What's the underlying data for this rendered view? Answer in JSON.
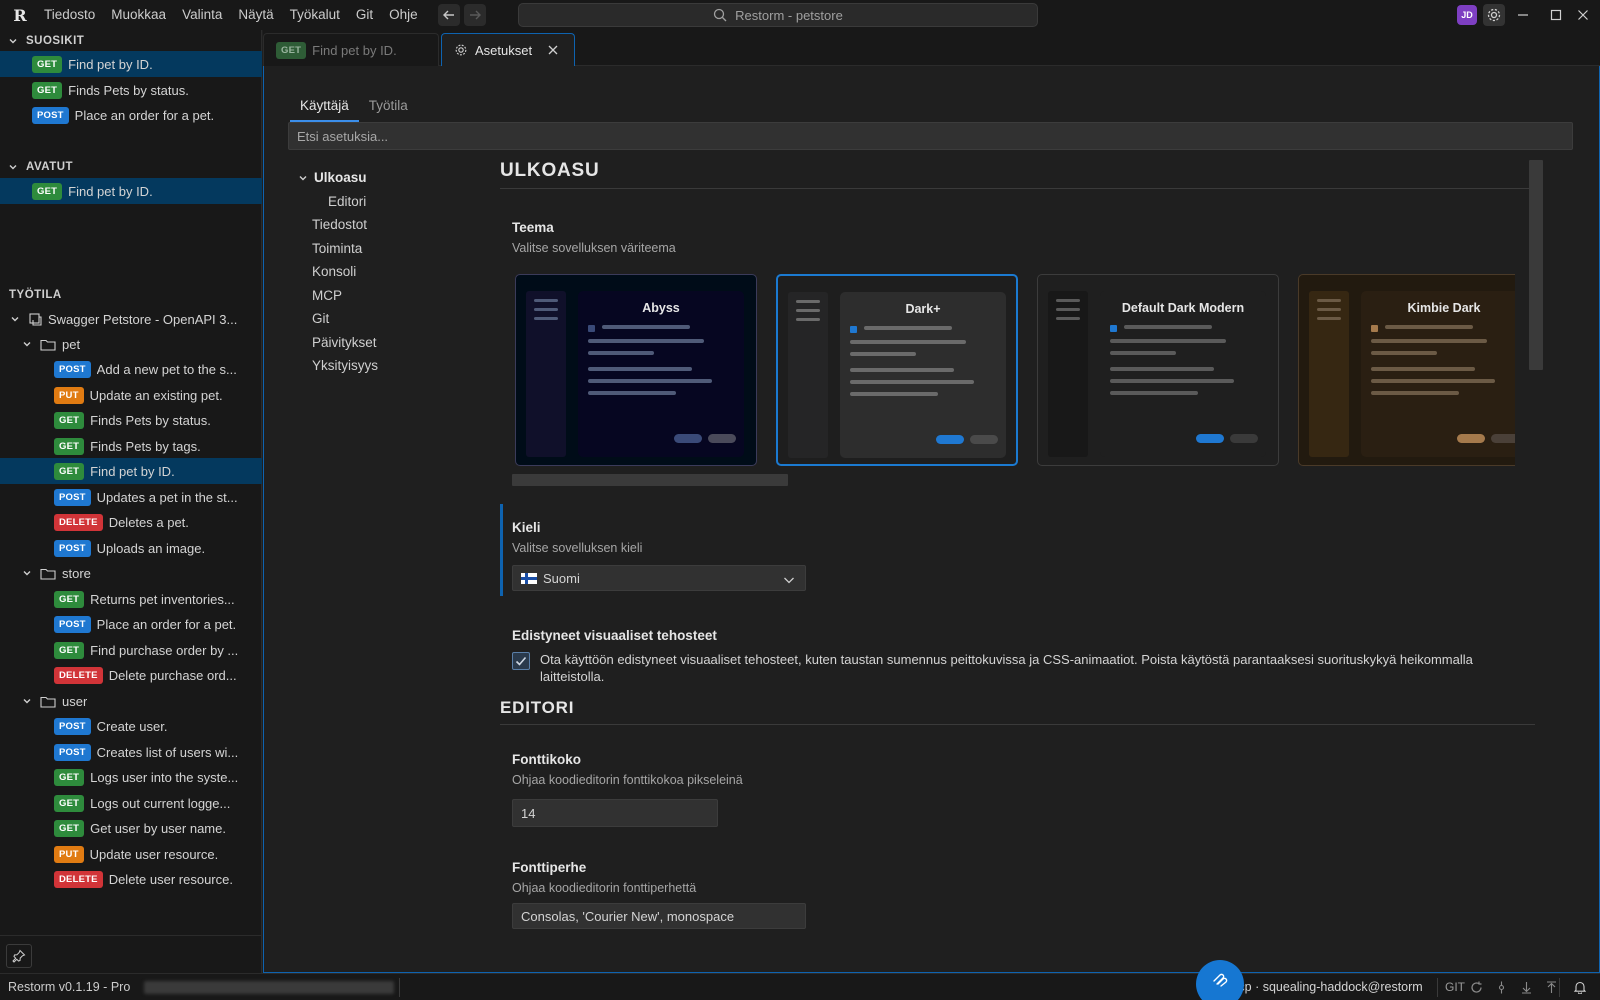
{
  "app": {
    "logo": "R",
    "menu": [
      "Tiedosto",
      "Muokkaa",
      "Valinta",
      "Näytä",
      "Työkalut",
      "Git",
      "Ohje"
    ],
    "search_title": "Restorm - petstore",
    "avatar_initials": "JD"
  },
  "sidebar": {
    "favorites_title": "SUOSIKIT",
    "favorites": [
      {
        "method": "GET",
        "label": "Find pet by ID.",
        "selected": true
      },
      {
        "method": "GET",
        "label": "Finds Pets by status."
      },
      {
        "method": "POST",
        "label": "Place an order for a pet."
      }
    ],
    "open_title": "AVATUT",
    "open": [
      {
        "method": "GET",
        "label": "Find pet by ID.",
        "selected": true
      }
    ],
    "workspace_title": "TYÖTILA",
    "collection": "Swagger Petstore - OpenAPI 3...",
    "folders": [
      {
        "name": "pet",
        "items": [
          {
            "method": "POST",
            "label": "Add a new pet to the s..."
          },
          {
            "method": "PUT",
            "label": "Update an existing pet."
          },
          {
            "method": "GET",
            "label": "Finds Pets by status."
          },
          {
            "method": "GET",
            "label": "Finds Pets by tags."
          },
          {
            "method": "GET",
            "label": "Find pet by ID.",
            "selected": true
          },
          {
            "method": "POST",
            "label": "Updates a pet in the st..."
          },
          {
            "method": "DELETE",
            "label": "Deletes a pet."
          },
          {
            "method": "POST",
            "label": "Uploads an image."
          }
        ]
      },
      {
        "name": "store",
        "items": [
          {
            "method": "GET",
            "label": "Returns pet inventories..."
          },
          {
            "method": "POST",
            "label": "Place an order for a pet."
          },
          {
            "method": "GET",
            "label": "Find purchase order by ..."
          },
          {
            "method": "DELETE",
            "label": "Delete purchase ord..."
          }
        ]
      },
      {
        "name": "user",
        "items": [
          {
            "method": "POST",
            "label": "Create user."
          },
          {
            "method": "POST",
            "label": "Creates list of users wi..."
          },
          {
            "method": "GET",
            "label": "Logs user into the syste..."
          },
          {
            "method": "GET",
            "label": "Logs out current logge..."
          },
          {
            "method": "GET",
            "label": "Get user by user name."
          },
          {
            "method": "PUT",
            "label": "Update user resource."
          },
          {
            "method": "DELETE",
            "label": "Delete user resource."
          }
        ]
      }
    ]
  },
  "tabs": {
    "request_tab": {
      "method": "GET",
      "label": "Find pet by ID."
    },
    "settings_tab": {
      "label": "Asetukset"
    }
  },
  "settings": {
    "scope_tabs": [
      "Käyttäjä",
      "Työtila"
    ],
    "search_placeholder": "Etsi asetuksia...",
    "toc": {
      "group": "Ulkoasu",
      "sub": "Editori",
      "items": [
        "Tiedostot",
        "Toiminta",
        "Konsoli",
        "MCP",
        "Git",
        "Päivitykset",
        "Yksityisyys"
      ]
    },
    "appearance": {
      "title": "ULKOASU",
      "theme_title": "Teema",
      "theme_desc": "Valitse sovelluksen väriteema",
      "themes": [
        {
          "name": "Abyss",
          "bg": "#000c18",
          "side": "#10102a",
          "panel": "#060621",
          "line": "#4f5a78",
          "dot": "#3a4a78",
          "btn1": "#3a4a78",
          "btn2": "#4a4a5a",
          "border": "#3b3b5a"
        },
        {
          "name": "Dark+",
          "bg": "#1e1e1e",
          "side": "#252526",
          "panel": "#2d2d2d",
          "line": "#6a6a6a",
          "dot": "#1f78d1",
          "btn1": "#1f78d1",
          "btn2": "#4a4a4a",
          "border": "#1b7ad1",
          "selected": true
        },
        {
          "name": "Default Dark Modern",
          "bg": "#1f1f1f",
          "side": "#181818",
          "panel": "#1f1f1f",
          "line": "#5a5a5a",
          "dot": "#1f78d1",
          "btn1": "#1f78d1",
          "btn2": "#3a3a3a",
          "border": "#3c3c3c"
        },
        {
          "name": "Kimbie Dark",
          "bg": "#221a0f",
          "side": "#362712",
          "panel": "#2a1f12",
          "line": "#6b5a45",
          "dot": "#a57a4c",
          "btn1": "#a57a4c",
          "btn2": "#4a4038",
          "border": "#4a3a28"
        }
      ],
      "language_title": "Kieli",
      "language_desc": "Valitse sovelluksen kieli",
      "language_value": "Suomi",
      "effects_title": "Edistyneet visuaaliset tehosteet",
      "effects_desc": "Ota käyttöön edistyneet visuaaliset tehosteet, kuten taustan sumennus peittokuvissa ja CSS-animaatiot. Poista käytöstä parantaaksesi suorituskykyä heikommalla laitteistolla.",
      "effects_checked": true
    },
    "editor": {
      "title": "EDITORI",
      "font_size_title": "Fonttikoko",
      "font_size_desc": "Ohjaa koodieditorin fonttikokoa pikseleinä",
      "font_size_value": "14",
      "font_family_title": "Fonttiperhe",
      "font_family_desc": "Ohjaa koodieditorin fonttiperhettä",
      "font_family_value": "Consolas, 'Courier New', monospace"
    }
  },
  "statusbar": {
    "version": "Restorm v0.1.19 - Pro",
    "mcp": "mcp · squealing-haddock@restorm",
    "git": "GIT"
  },
  "colors": {
    "accent": "#0e63b0",
    "get": "#2e8b3c",
    "post": "#1f78d1",
    "put": "#e07b12",
    "delete": "#d13438"
  }
}
